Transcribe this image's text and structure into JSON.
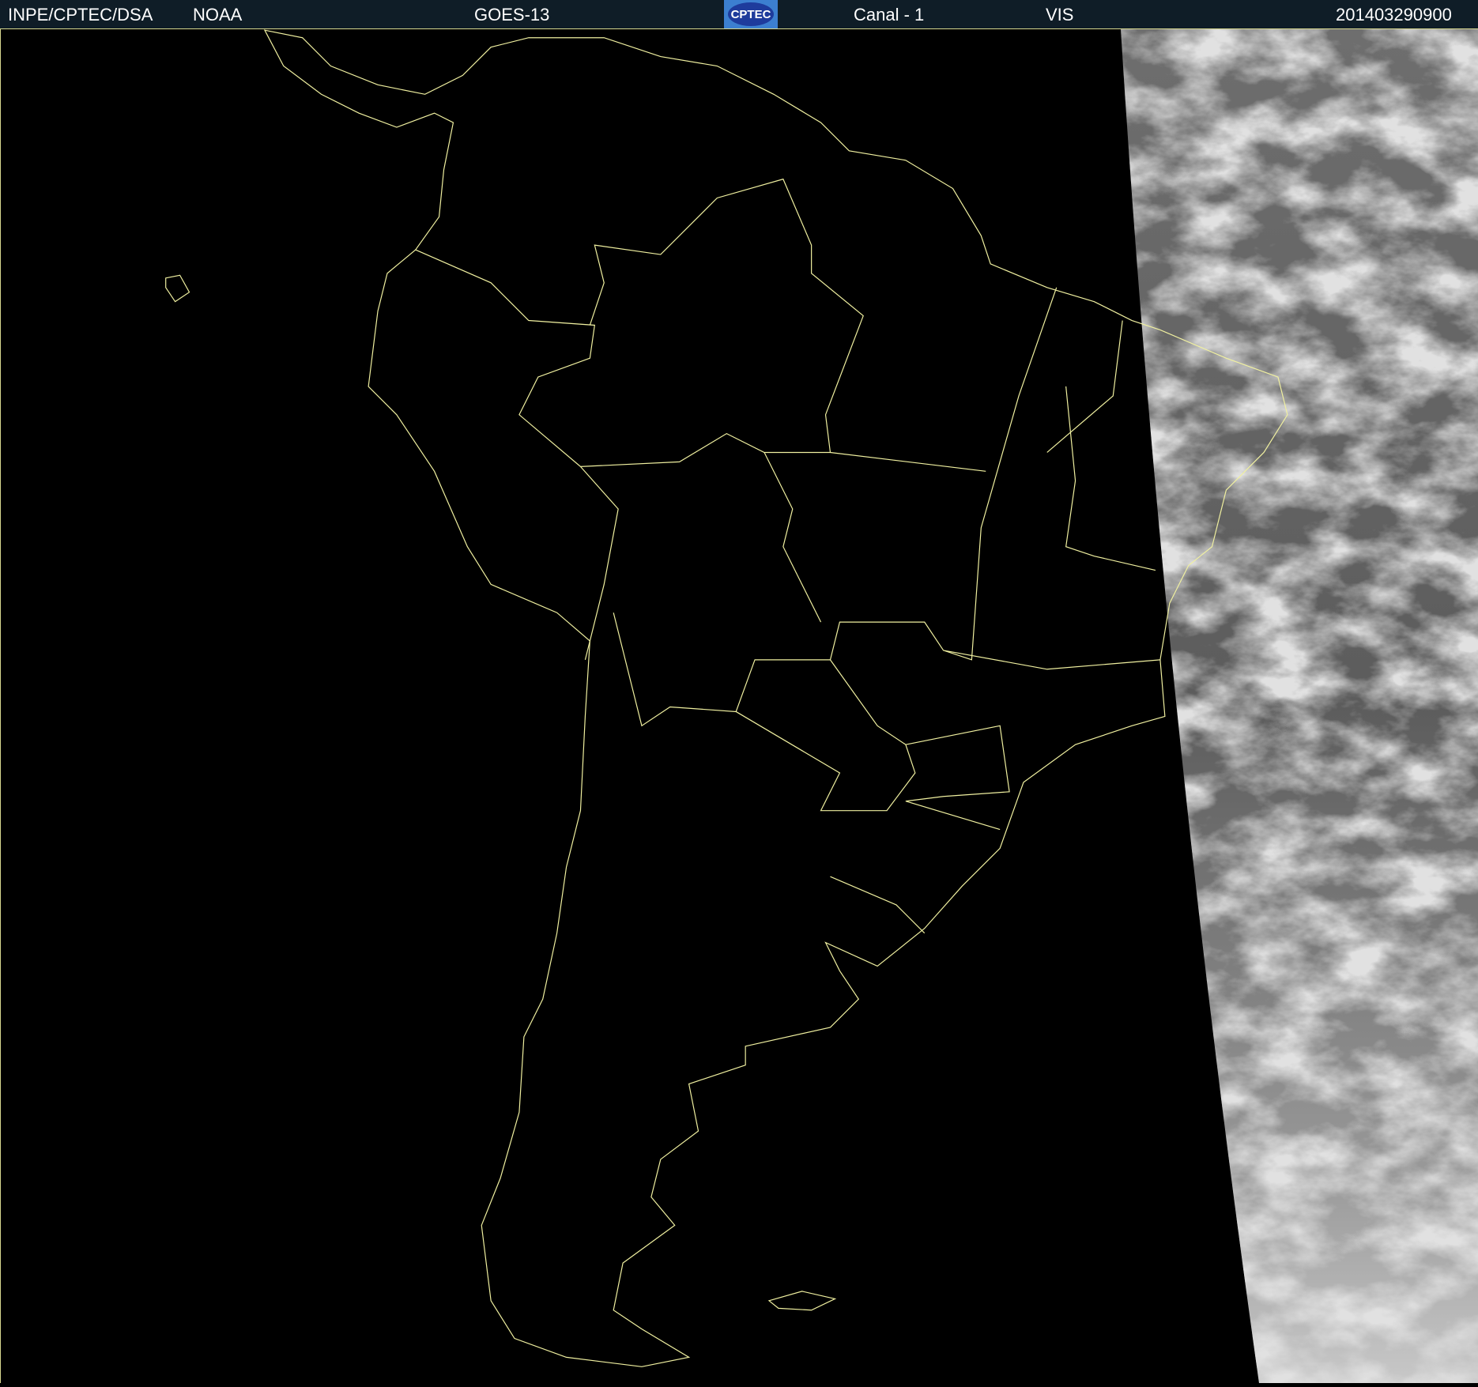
{
  "header": {
    "agency": "INPE/CPTEC/DSA",
    "source": "NOAA",
    "satellite": "GOES-13",
    "logo_text": "CPTEC",
    "channel": "Canal - 1",
    "band": "VIS",
    "timestamp": "201403290900"
  },
  "colors": {
    "header_bg": "#0f1d27",
    "outline": "#f0f0a0",
    "space": "#000000"
  }
}
